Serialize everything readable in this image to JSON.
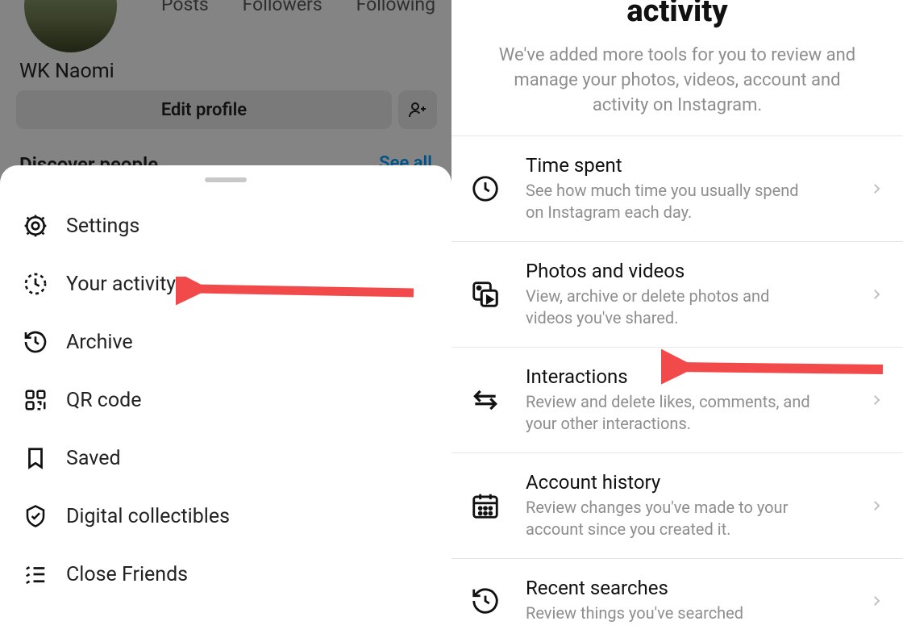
{
  "left": {
    "stats": {
      "posts": "Posts",
      "followers": "Followers",
      "following": "Following"
    },
    "display_name": "WK Naomi",
    "edit_profile": "Edit profile",
    "discover_people": "Discover people",
    "see_all": "See all",
    "menu": [
      {
        "label": "Settings",
        "icon": "gear"
      },
      {
        "label": "Your activity",
        "icon": "activity"
      },
      {
        "label": "Archive",
        "icon": "archive"
      },
      {
        "label": "QR code",
        "icon": "qr"
      },
      {
        "label": "Saved",
        "icon": "bookmark"
      },
      {
        "label": "Digital collectibles",
        "icon": "shield-check"
      },
      {
        "label": "Close Friends",
        "icon": "close-friends"
      }
    ]
  },
  "right": {
    "title": "activity",
    "subtitle": "We've added more tools for you to review and manage your photos, videos, account and activity on Instagram.",
    "items": [
      {
        "heading": "Time spent",
        "desc": "See how much time you usually spend on Instagram each day.",
        "icon": "clock"
      },
      {
        "heading": "Photos and videos",
        "desc": "View, archive or delete photos and videos you've shared.",
        "icon": "media"
      },
      {
        "heading": "Interactions",
        "desc": "Review and delete likes, comments, and your other interactions.",
        "icon": "arrows"
      },
      {
        "heading": "Account history",
        "desc": "Review changes you've made to your account since you created it.",
        "icon": "calendar"
      },
      {
        "heading": "Recent searches",
        "desc": "Review things you've searched",
        "icon": "history"
      }
    ]
  }
}
